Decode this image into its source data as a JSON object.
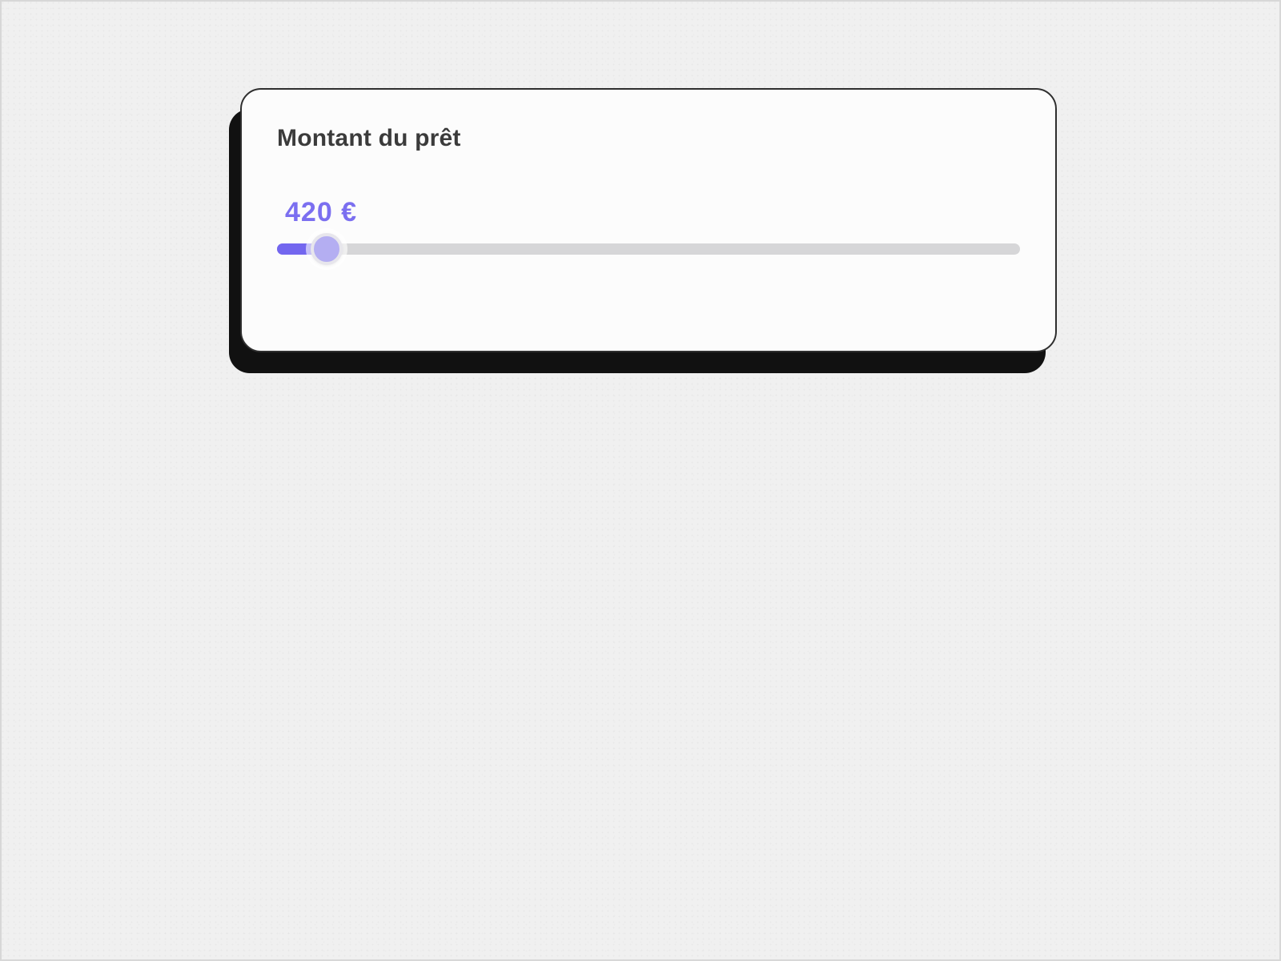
{
  "card": {
    "title": "Montant du prêt"
  },
  "slider": {
    "value_display": "420 €",
    "value": 420,
    "percent": 6,
    "colors": {
      "accent": "#7366ef",
      "thumb": "#b4aef2",
      "track": "#d6d6d8"
    }
  }
}
